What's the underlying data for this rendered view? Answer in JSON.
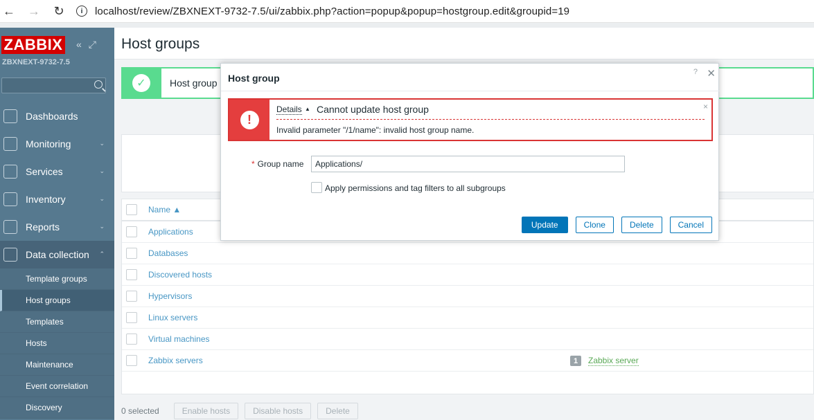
{
  "browser": {
    "back_icon": "←",
    "forward_icon": "→",
    "reload_icon": "↻",
    "info_icon": "i",
    "url": "localhost/review/ZBXNEXT-9732-7.5/ui/zabbix.php?action=popup&popup=hostgroup.edit&groupid=19"
  },
  "sidebar": {
    "logo": "ZABBIX",
    "collapse_icon": "«",
    "kiosk_icon": "⤢",
    "server_name": "ZBXNEXT-9732-7.5",
    "menu": [
      {
        "label": "Dashboards",
        "icon": "dashboards-icon"
      },
      {
        "label": "Monitoring",
        "icon": "monitoring-icon",
        "chevron": "⌄"
      },
      {
        "label": "Services",
        "icon": "services-icon",
        "chevron": "⌄"
      },
      {
        "label": "Inventory",
        "icon": "inventory-icon",
        "chevron": "⌄"
      },
      {
        "label": "Reports",
        "icon": "reports-icon",
        "chevron": "⌄"
      },
      {
        "label": "Data collection",
        "icon": "data-collection-icon",
        "chevron": "⌃"
      }
    ],
    "submenu": [
      "Template groups",
      "Host groups",
      "Templates",
      "Hosts",
      "Maintenance",
      "Event correlation",
      "Discovery"
    ]
  },
  "main": {
    "title": "Host groups",
    "success_text": "Host group",
    "check_icon": "✓",
    "table": {
      "header_name": "Name ▲",
      "rows": [
        {
          "name": "Applications"
        },
        {
          "name": "Databases"
        },
        {
          "name": "Discovered hosts"
        },
        {
          "name": "Hypervisors"
        },
        {
          "name": "Linux servers"
        },
        {
          "name": "Virtual machines"
        },
        {
          "name": "Zabbix servers",
          "count": "1",
          "host": "Zabbix server"
        }
      ]
    },
    "bottom": {
      "selected": "0 selected",
      "enable": "Enable hosts",
      "disable": "Disable hosts",
      "delete": "Delete"
    }
  },
  "modal": {
    "title": "Host group",
    "help": "?",
    "close": "✕",
    "error": {
      "icon": "!",
      "details_label": "Details",
      "details_arrow": "▲",
      "title": "Cannot update host group",
      "detail": "Invalid parameter \"/1/name\": invalid host group name.",
      "close": "×"
    },
    "form": {
      "required_mark": "*",
      "group_name_label": "Group name",
      "group_name_value": "Applications/",
      "apply_label": "Apply permissions and tag filters to all subgroups"
    },
    "buttons": {
      "update": "Update",
      "clone": "Clone",
      "delete": "Delete",
      "cancel": "Cancel"
    }
  }
}
